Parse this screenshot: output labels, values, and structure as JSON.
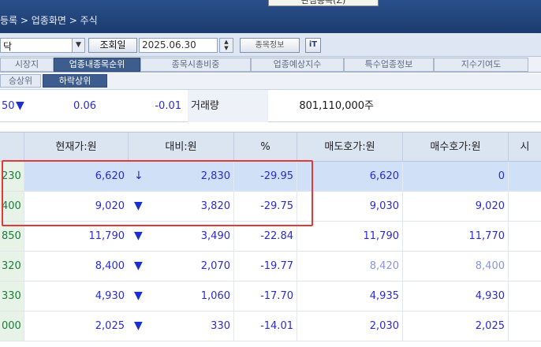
{
  "titlebar": {
    "breadcrumb": "등록 > 업종화면 > 주식",
    "tooltip": "관심종목(Z)"
  },
  "toolbar": {
    "combo_value": "닥",
    "query_label": "조회일",
    "date_value": "2025.06.30",
    "info_button": "종목정보",
    "extra_icon": "iT"
  },
  "tabs": [
    "시장지",
    "업종내종목순위",
    "종목시총비중",
    "업종예상지수",
    "특수업종정보",
    "지수기여도"
  ],
  "subtabs": [
    "승상위",
    "하락상위"
  ],
  "summary": {
    "left_value": "50",
    "change": "0.06",
    "pct": "-0.01",
    "volume_label": "거래량",
    "volume_value": "801,110,000주"
  },
  "table": {
    "headers": [
      "현재가:원",
      "대비:원",
      "%",
      "매도호가:원",
      "매수호가:원",
      "시"
    ],
    "rows": [
      {
        "code": "230",
        "price": "6,620",
        "arrow": "↓",
        "diff": "2,830",
        "pct": "-29.95",
        "ask": "6,620",
        "bid": "0"
      },
      {
        "code": "400",
        "price": "9,020",
        "arrow": "▼",
        "diff": "3,820",
        "pct": "-29.75",
        "ask": "9,030",
        "bid": "9,020"
      },
      {
        "code": "850",
        "price": "11,790",
        "arrow": "▼",
        "diff": "3,490",
        "pct": "-22.84",
        "ask": "11,790",
        "bid": "11,770"
      },
      {
        "code": "320",
        "price": "8,400",
        "arrow": "▼",
        "diff": "2,070",
        "pct": "-19.77",
        "ask": "8,420",
        "bid": "8,400"
      },
      {
        "code": "330",
        "price": "4,930",
        "arrow": "▼",
        "diff": "1,060",
        "pct": "-17.70",
        "ask": "4,935",
        "bid": "4,930"
      },
      {
        "code": "000",
        "price": "2,025",
        "arrow": "▼",
        "diff": "330",
        "pct": "-14.01",
        "ask": "2,030",
        "bid": "2,025"
      }
    ]
  },
  "colors": {
    "accent": "#3d5d8e",
    "down": "#1b2fd0",
    "highlight": "#e23a3a"
  },
  "icons": {
    "down_arrow": "down-triangle-icon",
    "dropdown": "chevron-down-icon"
  }
}
